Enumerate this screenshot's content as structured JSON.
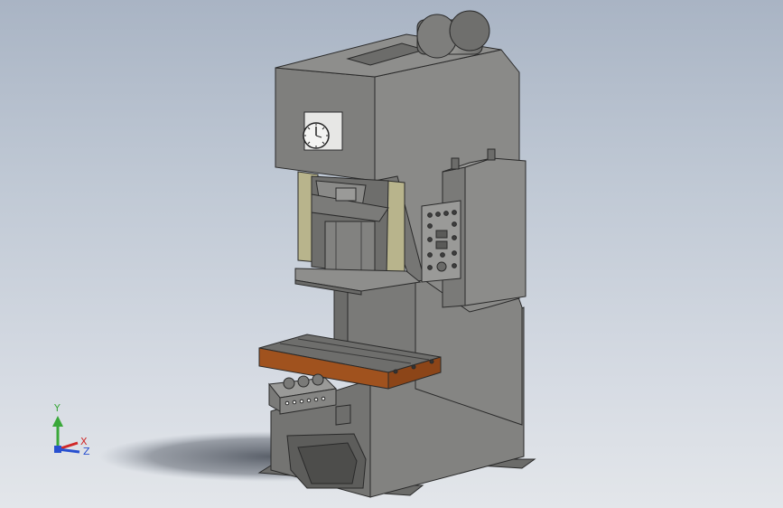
{
  "viewport": {
    "model": "c-frame-power-press",
    "background_top": "#a9b4c4",
    "background_bottom": "#e3e6ea"
  },
  "colors": {
    "body_gray": "#7d7d7b",
    "body_light": "#8c8c89",
    "body_dark": "#5f5f5d",
    "guide_olive": "#b8b48c",
    "table_brown": "#a0521e",
    "table_top": "#6e6e6c",
    "panel_gray": "#9a9a98",
    "shadow": "#5a5f68"
  },
  "triad": {
    "y_label": "Y",
    "x_label": "X",
    "z_label": "Z",
    "y_color": "#3aa83a",
    "x_color": "#d02828",
    "z_color": "#2850d0"
  }
}
